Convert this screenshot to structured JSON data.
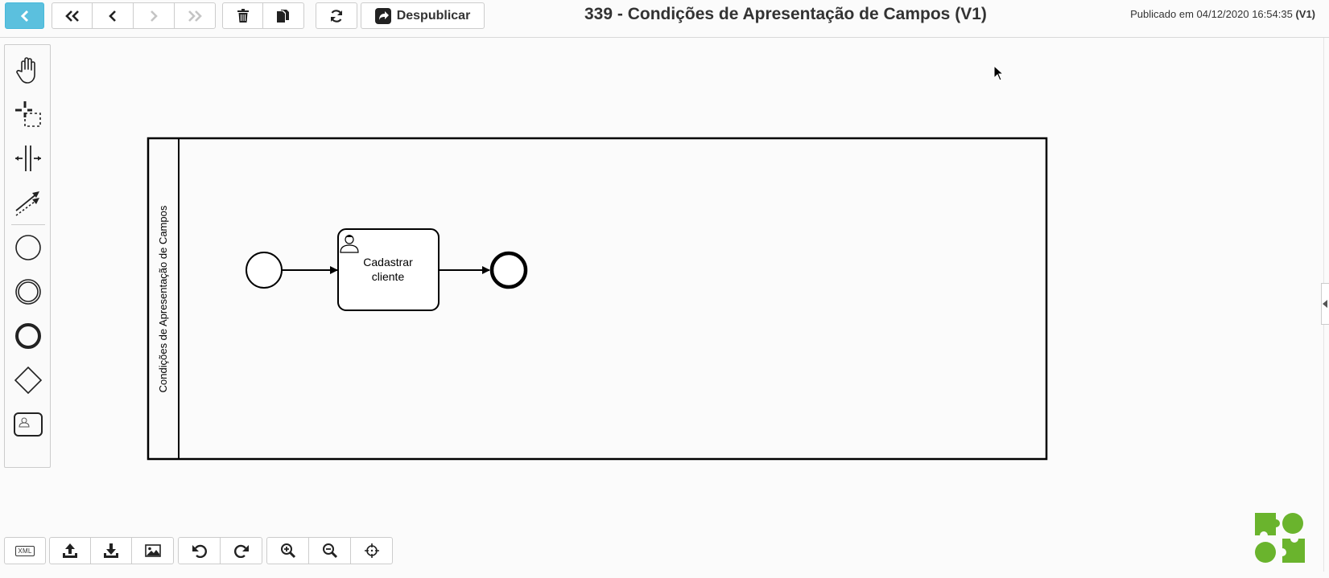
{
  "toolbar": {
    "despublicar_label": "Despublicar"
  },
  "header": {
    "title": "339 - Condições de Apresentação de Campos (V1)",
    "published_prefix": "Publicado em 04/12/2020 16:54:35",
    "published_version": "(V1)"
  },
  "palette": {
    "tools": [
      "hand-tool",
      "lasso-tool",
      "space-tool",
      "global-connect-tool",
      "start-event",
      "intermediate-event",
      "end-event",
      "gateway",
      "user-task"
    ]
  },
  "diagram": {
    "lane_label": "Condições de Apresentação de Campos",
    "task_label_line1": "Cadastrar",
    "task_label_line2": "cliente"
  },
  "bottombar": {
    "xml_label": "XML"
  },
  "colors": {
    "accent": "#5bc0de",
    "logo_green": "#6ab42d",
    "stroke": "#000000"
  }
}
